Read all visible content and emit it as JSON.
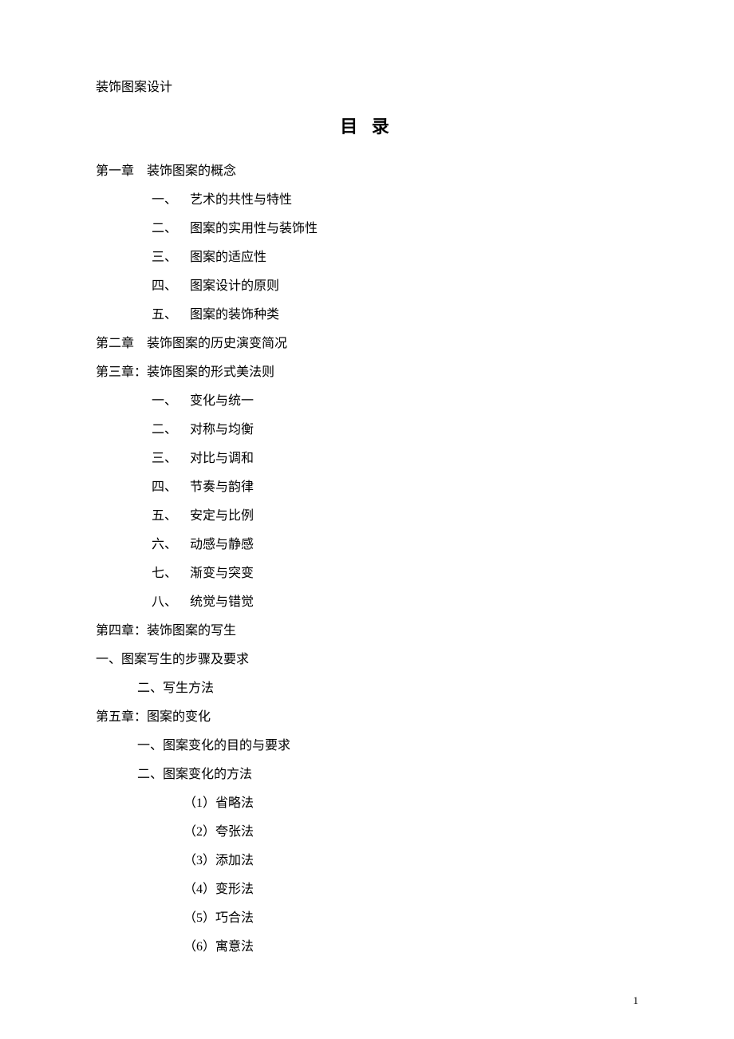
{
  "doc_title": "装饰图案设计",
  "toc_heading": "目 录",
  "lines": [
    {
      "cls": "indent-0",
      "text": "第一章    装饰图案的概念"
    },
    {
      "cls": "indent-1",
      "text": "一、    艺术的共性与特性"
    },
    {
      "cls": "indent-1",
      "text": "二、    图案的实用性与装饰性"
    },
    {
      "cls": "indent-1",
      "text": "三、    图案的适应性"
    },
    {
      "cls": "indent-1",
      "text": "四、    图案设计的原则"
    },
    {
      "cls": "indent-1",
      "text": "五、    图案的装饰种类"
    },
    {
      "cls": "indent-0",
      "text": "第二章    装饰图案的历史演变简况"
    },
    {
      "cls": "indent-0",
      "text": "第三章：装饰图案的形式美法则"
    },
    {
      "cls": "indent-1",
      "text": "一、    变化与统一"
    },
    {
      "cls": "indent-1",
      "text": "二、    对称与均衡"
    },
    {
      "cls": "indent-1",
      "text": "三、    对比与调和"
    },
    {
      "cls": "indent-1",
      "text": "四、    节奏与韵律"
    },
    {
      "cls": "indent-1",
      "text": "五、    安定与比例"
    },
    {
      "cls": "indent-1",
      "text": "六、    动感与静感"
    },
    {
      "cls": "indent-1",
      "text": "七、    渐变与突变"
    },
    {
      "cls": "indent-1",
      "text": "八、    统觉与错觉"
    },
    {
      "cls": "indent-0",
      "text": "第四章：装饰图案的写生"
    },
    {
      "cls": "indent-0",
      "text": "一、图案写生的步骤及要求"
    },
    {
      "cls": "indent-1b",
      "text": "二、写生方法"
    },
    {
      "cls": "indent-0",
      "text": "第五章：图案的变化"
    },
    {
      "cls": "indent-1b",
      "text": "一、图案变化的目的与要求"
    },
    {
      "cls": "indent-1b",
      "text": "二、图案变化的方法"
    },
    {
      "cls": "indent-2",
      "text": "（1）省略法"
    },
    {
      "cls": "indent-2",
      "text": "（2）夸张法"
    },
    {
      "cls": "indent-2",
      "text": "（3）添加法"
    },
    {
      "cls": "indent-2",
      "text": "（4）变形法"
    },
    {
      "cls": "indent-2",
      "text": "（5）巧合法"
    },
    {
      "cls": "indent-2",
      "text": "（6）寓意法"
    }
  ],
  "page_number": "1"
}
